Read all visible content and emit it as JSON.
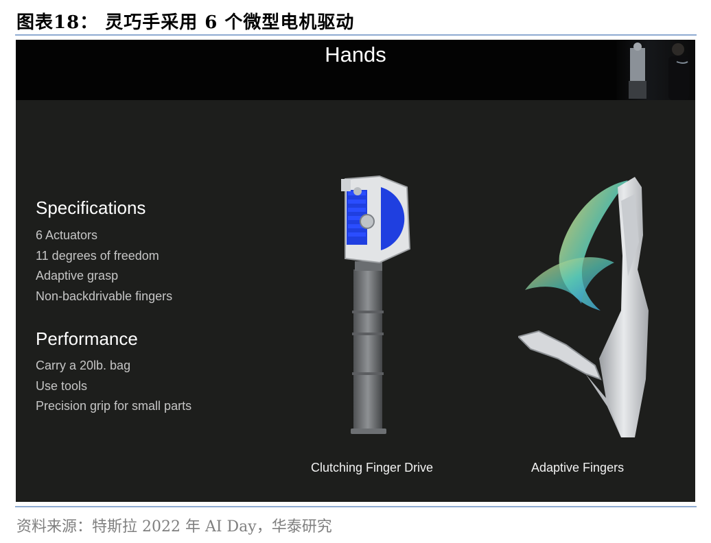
{
  "figure_title": "图表18：  灵巧手采用 6 个微型电机驱动",
  "slide": {
    "title": "Hands",
    "specifications": {
      "heading": "Specifications",
      "items": [
        "6 Actuators",
        "11 degrees of freedom",
        "Adaptive grasp",
        "Non-backdrivable fingers"
      ]
    },
    "performance": {
      "heading": "Performance",
      "items": [
        "Carry a 20lb. bag",
        "Use tools",
        "Precision grip for small parts"
      ]
    },
    "captions": {
      "left": "Clutching Finger Drive",
      "right": "Adaptive Fingers"
    }
  },
  "source": "资料来源：特斯拉 2022 年 AI Day，华泰研究",
  "colors": {
    "accent_rule": "#8eaad1",
    "gear_blue": "#1f3fe0",
    "slide_bg": "#1d1e1c"
  }
}
